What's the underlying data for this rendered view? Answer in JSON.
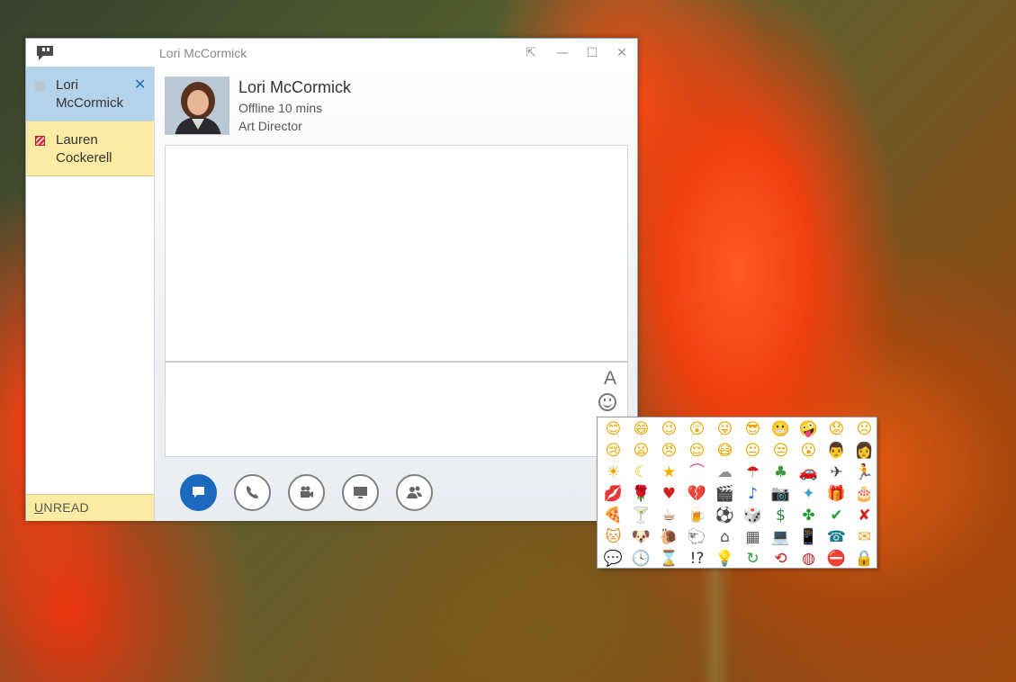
{
  "window": {
    "title": "Lori McCormick"
  },
  "sidebar": {
    "conversations": [
      {
        "name": "Lori McCormick",
        "presence": "offline",
        "active": true
      },
      {
        "name": "Lauren Cockerell",
        "presence": "do-not-disturb",
        "active": false
      }
    ],
    "unread_label": "UNREAD",
    "unread_hotkey": "U"
  },
  "contact": {
    "name": "Lori McCormick",
    "status": "Offline 10 mins",
    "title": "Art Director"
  },
  "compose": {
    "font_button_label": "A",
    "emoticon_icon": "smiley-icon"
  },
  "actions": [
    {
      "name": "im-button",
      "icon": "chat-bubble-icon"
    },
    {
      "name": "call-button",
      "icon": "phone-icon"
    },
    {
      "name": "video-button",
      "icon": "video-camera-icon"
    },
    {
      "name": "present-button",
      "icon": "monitor-icon"
    },
    {
      "name": "participants-button",
      "icon": "people-icon"
    }
  ],
  "colors": {
    "accent": "#1c6ac0",
    "active_conversation": "#b4d3ea",
    "unread_background": "#fbeba3"
  },
  "emoticons": [
    {
      "c": "😊",
      "color": "#e8a800"
    },
    {
      "c": "😄",
      "color": "#e8a800"
    },
    {
      "c": "😉",
      "color": "#e8a800"
    },
    {
      "c": "😲",
      "color": "#e8a800"
    },
    {
      "c": "😛",
      "color": "#e8a800"
    },
    {
      "c": "😎",
      "color": "#e8a800"
    },
    {
      "c": "😬",
      "color": "#e8a800"
    },
    {
      "c": "🤪",
      "color": "#e8a800"
    },
    {
      "c": "😟",
      "color": "#e8a800"
    },
    {
      "c": "☹",
      "color": "#e8a800"
    },
    {
      "c": "😢",
      "color": "#e8a800"
    },
    {
      "c": "😦",
      "color": "#e8a800"
    },
    {
      "c": "😠",
      "color": "#e8a800"
    },
    {
      "c": "😌",
      "color": "#e8a800"
    },
    {
      "c": "😷",
      "color": "#e8a800"
    },
    {
      "c": "😐",
      "color": "#e8a800"
    },
    {
      "c": "😒",
      "color": "#e8a800"
    },
    {
      "c": "😮",
      "color": "#e8a800"
    },
    {
      "c": "👨",
      "color": "#2a5aa0"
    },
    {
      "c": "👩",
      "color": "#c03030"
    },
    {
      "c": "☀",
      "color": "#f0a400"
    },
    {
      "c": "☾",
      "color": "#e8b800"
    },
    {
      "c": "★",
      "color": "#f0b400"
    },
    {
      "c": "⌒",
      "color": "#d0507a"
    },
    {
      "c": "☁",
      "color": "#8f8f8f"
    },
    {
      "c": "☂",
      "color": "#d02020"
    },
    {
      "c": "♣",
      "color": "#3a9a3a"
    },
    {
      "c": "🚗",
      "color": "#d02020"
    },
    {
      "c": "✈",
      "color": "#444444"
    },
    {
      "c": "🏃",
      "color": "#444444"
    },
    {
      "c": "💋",
      "color": "#d02020"
    },
    {
      "c": "🌹",
      "color": "#d02020"
    },
    {
      "c": "♥",
      "color": "#d02020"
    },
    {
      "c": "💔",
      "color": "#c02020"
    },
    {
      "c": "🎬",
      "color": "#333333"
    },
    {
      "c": "♪",
      "color": "#1c6ac0"
    },
    {
      "c": "📷",
      "color": "#c02020"
    },
    {
      "c": "✦",
      "color": "#3aa0d0"
    },
    {
      "c": "🎁",
      "color": "#2aa0c0"
    },
    {
      "c": "🎂",
      "color": "#e04080"
    },
    {
      "c": "🍕",
      "color": "#e09020"
    },
    {
      "c": "🍸",
      "color": "#2a9a7a"
    },
    {
      "c": "☕",
      "color": "#8a4a20"
    },
    {
      "c": "🍺",
      "color": "#e0a020"
    },
    {
      "c": "⚽",
      "color": "#333333"
    },
    {
      "c": "🎲",
      "color": "#c02020"
    },
    {
      "c": "$",
      "color": "#2a8a3a"
    },
    {
      "c": "✤",
      "color": "#2a9a3a"
    },
    {
      "c": "✔",
      "color": "#2aa040"
    },
    {
      "c": "✘",
      "color": "#d02020"
    },
    {
      "c": "🐱",
      "color": "#e09020"
    },
    {
      "c": "🐶",
      "color": "#c08030"
    },
    {
      "c": "🐌",
      "color": "#8a6a20"
    },
    {
      "c": "🐑",
      "color": "#333333"
    },
    {
      "c": "⌂",
      "color": "#555555"
    },
    {
      "c": "▦",
      "color": "#555555"
    },
    {
      "c": "💻",
      "color": "#555555"
    },
    {
      "c": "📱",
      "color": "#1c4a8a"
    },
    {
      "c": "☎",
      "color": "#1a7a8a"
    },
    {
      "c": "✉",
      "color": "#e0a020"
    },
    {
      "c": "💬",
      "color": "#555555"
    },
    {
      "c": "🕓",
      "color": "#333333"
    },
    {
      "c": "⌛",
      "color": "#888888"
    },
    {
      "c": "!?",
      "color": "#333333"
    },
    {
      "c": "💡",
      "color": "#e8b800"
    },
    {
      "c": "↻",
      "color": "#2aa040"
    },
    {
      "c": "⟲",
      "color": "#d02020"
    },
    {
      "c": "◍",
      "color": "#c02020"
    },
    {
      "c": "⛔",
      "color": "#d02020"
    },
    {
      "c": "🔒",
      "color": "#777777"
    }
  ]
}
